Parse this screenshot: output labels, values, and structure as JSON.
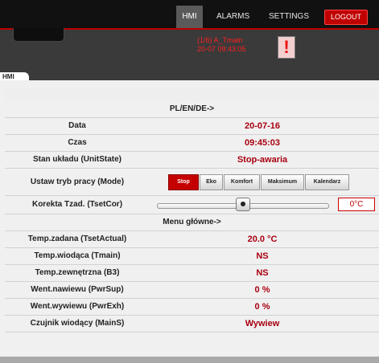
{
  "nav": {
    "hmi": "HMI",
    "alarms": "ALARMS",
    "settings": "SETTINGS",
    "logout": "LOGOUT"
  },
  "alarm": {
    "line1": "(1/6) A_Tmain",
    "line2": "20-07 09:43:05",
    "icon_text": "!"
  },
  "breadcrumb": {
    "label": "HMI"
  },
  "section1": {
    "title": "PL/EN/DE->"
  },
  "rows": {
    "data": {
      "label": "Data",
      "value": "20-07-16"
    },
    "czas": {
      "label": "Czas",
      "value": "09:45:03"
    },
    "stan": {
      "label": "Stan układu (UnitState)",
      "value": "Stop-awaria"
    },
    "mode": {
      "label": "Ustaw tryb pracy (Mode)",
      "options": [
        "Stop",
        "Eko",
        "Komfort",
        "Maksimum",
        "Kalendarz"
      ],
      "active": "Stop"
    },
    "korekta": {
      "label": "Korekta Tzad. (TsetCor)",
      "value": "0°C",
      "slider_fraction": 0.5
    }
  },
  "section2": {
    "title": "Menu główne->"
  },
  "menu": {
    "tset": {
      "label": "Temp.zadana (TsetActual)",
      "value": "20.0 °C"
    },
    "tmain": {
      "label": "Temp.wiodąca (Tmain)",
      "value": "NS"
    },
    "b3": {
      "label": "Temp.zewnętrzna (B3)",
      "value": "NS"
    },
    "pwrsup": {
      "label": "Went.nawiewu (PwrSup)",
      "value": "0 %"
    },
    "pwrexh": {
      "label": "Went.wywiewu (PwrExh)",
      "value": "0 %"
    },
    "mains": {
      "label": "Czujnik wiodący (MainS)",
      "value": "Wywiew"
    }
  },
  "colors": {
    "accent_red": "#c40000",
    "value_red": "#a80010",
    "topbar": "#111111",
    "header": "#3a3a3a"
  },
  "icons": {
    "alarm": "exclamation-icon",
    "slider": "slider-thumb-icon"
  }
}
